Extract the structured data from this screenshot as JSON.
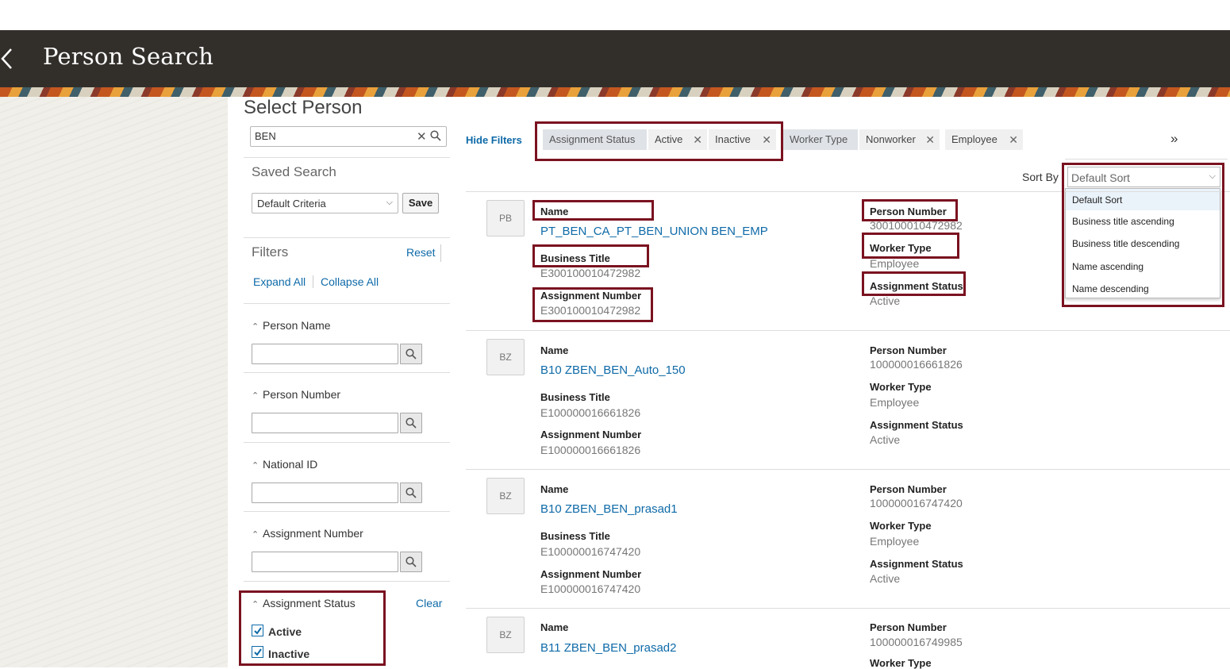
{
  "header": {
    "title": "Person Search"
  },
  "page": {
    "title": "Select Person"
  },
  "search": {
    "value": "BEN"
  },
  "saved_search": {
    "label": "Saved Search",
    "selected": "Default Criteria",
    "save_label": "Save"
  },
  "filters": {
    "label": "Filters",
    "reset": "Reset",
    "expand_all": "Expand All",
    "collapse_all": "Collapse All"
  },
  "facets": [
    {
      "label": "Person Name"
    },
    {
      "label": "Person Number"
    },
    {
      "label": "National ID"
    },
    {
      "label": "Assignment Number"
    }
  ],
  "assignment_status_facet": {
    "label": "Assignment Status",
    "clear": "Clear",
    "options": [
      {
        "label": "Active",
        "checked": true
      },
      {
        "label": "Inactive",
        "checked": true
      }
    ]
  },
  "filter_bar": {
    "hide_filters": "Hide Filters",
    "chips": [
      {
        "label": "Assignment Status",
        "type": "heading"
      },
      {
        "label": "Active",
        "type": "value"
      },
      {
        "label": "Inactive",
        "type": "value"
      },
      {
        "label": "Worker Type",
        "type": "heading"
      },
      {
        "label": "Nonworker",
        "type": "value"
      },
      {
        "label": "Employee",
        "type": "value"
      }
    ]
  },
  "sort": {
    "label": "Sort By",
    "selected": "Default Sort",
    "options": [
      "Default Sort",
      "Business title ascending",
      "Business title descending",
      "Name ascending",
      "Name descending"
    ]
  },
  "field_labels": {
    "name": "Name",
    "business_title": "Business Title",
    "assignment_number": "Assignment Number",
    "person_number": "Person Number",
    "worker_type": "Worker Type",
    "assignment_status": "Assignment Status"
  },
  "results": [
    {
      "initials": "PB",
      "name": "PT_BEN_CA_PT_BEN_UNION BEN_EMP",
      "business_title": "E300100010472982",
      "assignment_number": "E300100010472982",
      "person_number": "300100010472982",
      "worker_type": "Employee",
      "assignment_status": "Active"
    },
    {
      "initials": "BZ",
      "name": "B10 ZBEN_BEN_Auto_150",
      "business_title": "E100000016661826",
      "assignment_number": "E100000016661826",
      "person_number": "100000016661826",
      "worker_type": "Employee",
      "assignment_status": "Active"
    },
    {
      "initials": "BZ",
      "name": "B10 ZBEN_BEN_prasad1",
      "business_title": "E100000016747420",
      "assignment_number": "E100000016747420",
      "person_number": "100000016747420",
      "worker_type": "Employee",
      "assignment_status": "Active"
    },
    {
      "initials": "BZ",
      "name": "B11 ZBEN_BEN_prasad2",
      "business_title": "",
      "assignment_number": "",
      "person_number": "100000016749985",
      "worker_type": "",
      "assignment_status": ""
    }
  ],
  "colors": {
    "header_bg": "#322f2b",
    "link": "#0e6aa8",
    "highlight_box": "#7a1220"
  }
}
